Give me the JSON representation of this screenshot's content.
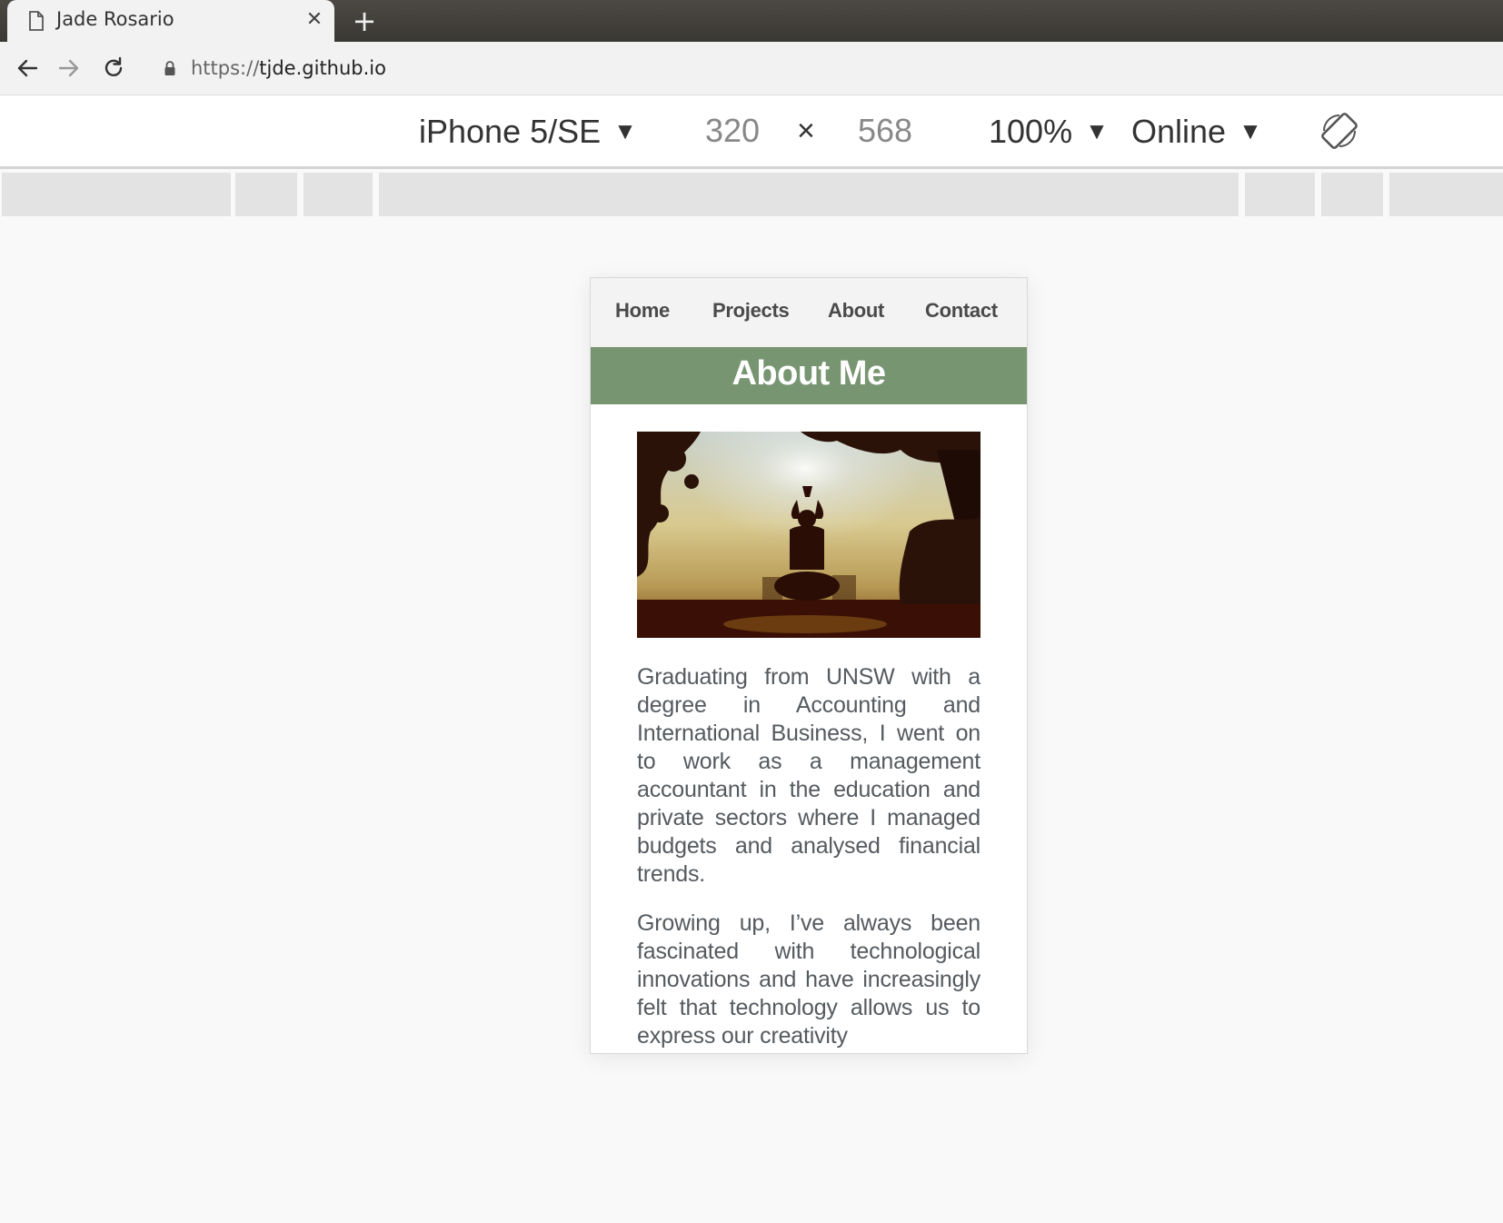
{
  "browser": {
    "tab_title": "Jade Rosario",
    "tab_close": "✕",
    "new_tab": "+",
    "url_scheme": "https://",
    "url_host": "tjde.github.io"
  },
  "device_toolbar": {
    "device": "iPhone 5/SE",
    "width": "320",
    "times": "×",
    "height": "568",
    "zoom": "100%",
    "network": "Online",
    "caret": "▼"
  },
  "site": {
    "nav": [
      "Home",
      "Projects",
      "About",
      "Contact"
    ],
    "hero_title": "About Me",
    "paragraphs": [
      "Graduating from UNSW with a degree in Accounting and International Business, I went on to work as a management accountant in the education and private sectors where I managed budgets and analysed financial trends.",
      "Growing up, I’ve always been fascinated with technological innovations and have increasingly felt that technology allows us to express our creativity"
    ]
  },
  "colors": {
    "hero_bg": "#789572",
    "nav_bg": "#f3f3f3",
    "tab_strip": "#3f3d38"
  }
}
